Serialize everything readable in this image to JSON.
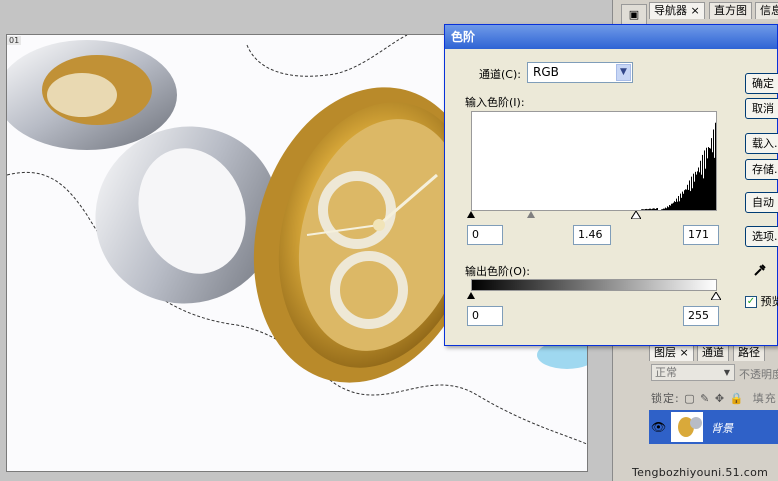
{
  "document": {
    "tag": "01"
  },
  "panel": {
    "tool_icon": "image-tool-icon",
    "top_tabs": [
      {
        "label": "导航器",
        "close": "×"
      },
      {
        "label": "直方图"
      },
      {
        "label": "信息"
      }
    ],
    "layer_tabs": [
      {
        "label": "图层",
        "close": "×"
      },
      {
        "label": "通道"
      },
      {
        "label": "路径"
      }
    ],
    "blend_mode": "正常",
    "opacity_label": "不透明度",
    "lock_label": "锁定:",
    "fill_label": "填充",
    "layer_name": "背景"
  },
  "dialog": {
    "title": "色阶",
    "channel_label": "通道(C):",
    "channel_value": "RGB",
    "input_label": "输入色阶(I):",
    "input_black": "0",
    "input_gamma": "1.46",
    "input_white": "171",
    "output_label": "输出色阶(O):",
    "output_black": "0",
    "output_white": "255",
    "buttons": {
      "ok": "确定",
      "cancel": "取消",
      "load": "载入...",
      "save": "存储...",
      "auto": "自动",
      "options": "选项..."
    },
    "preview_label": "预览",
    "preview_checked": true
  },
  "watermark": "Tengbozhiyouni.51.com",
  "colors": {
    "title_bar": "#2e63d4",
    "layer_selected": "#2f61c8",
    "gold": "#d9a93a"
  }
}
